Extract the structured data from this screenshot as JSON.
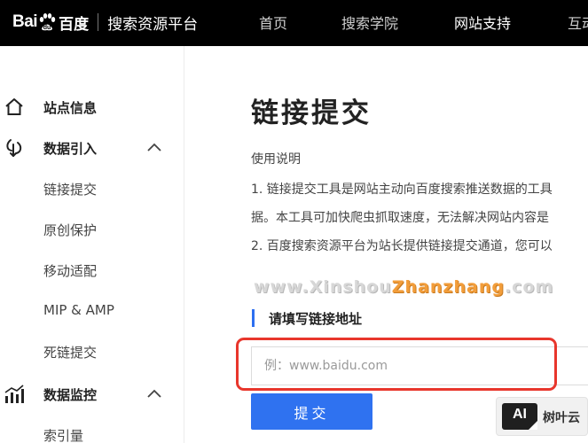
{
  "header": {
    "logo_left": "Bai",
    "logo_right": "du",
    "logo_cn": "百度",
    "platform_name": "搜索资源平台",
    "nav": [
      "首页",
      "搜索学院",
      "网站支持",
      "互动"
    ]
  },
  "sidebar": {
    "site_info": "站点信息",
    "data_import": {
      "label": "数据引入",
      "items": [
        "链接提交",
        "原创保护",
        "移动适配",
        "MIP & AMP",
        "死链提交"
      ]
    },
    "data_monitor": {
      "label": "数据监控",
      "items": [
        "索引量"
      ]
    }
  },
  "main": {
    "title": "链接提交",
    "usage_heading": "使用说明",
    "usage_lines": [
      "1. 链接提交工具是网站主动向百度搜索推送数据的工具",
      "据。本工具可加快爬虫抓取速度，无法解决网站内容是",
      "2. 百度搜索资源平台为站长提供链接提交通道，您可以"
    ],
    "watermark_prefix": "www.Xinshou",
    "watermark_highlight": "Zhanzhang",
    "watermark_suffix": ".com",
    "field_label": "请填写链接地址",
    "url_placeholder": "例：www.baidu.com",
    "submit_label": "提交"
  },
  "badge": {
    "icon_text": "AI",
    "text": "树叶云"
  },
  "colors": {
    "topbar": "#000000",
    "accent_blue": "#2f72f0",
    "highlight_red": "#e8362c",
    "watermark_orange": "#f29d3a"
  }
}
